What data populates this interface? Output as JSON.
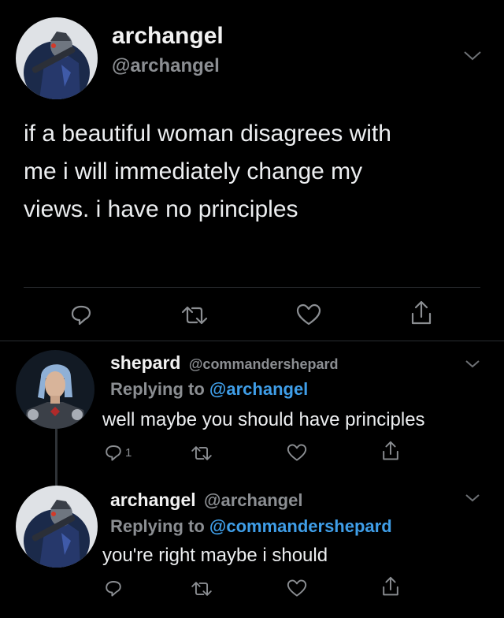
{
  "main_tweet": {
    "display_name": "archangel",
    "handle": "@archangel",
    "text_lines": [
      "if a beautiful woman disagrees with",
      "me i will immediately change my",
      "views. i have no principles"
    ],
    "avatar_icon": "garrus-avatar-icon"
  },
  "reply1": {
    "display_name": "shepard",
    "handle": "@commandershepard",
    "replying_label": "Replying to",
    "replying_to": "@archangel",
    "text": "well maybe you should have principles",
    "reply_count": "1",
    "avatar_icon": "shepard-avatar-icon"
  },
  "reply2": {
    "display_name": "archangel",
    "handle": "@archangel",
    "replying_label": "Replying to",
    "replying_to": "@commandershepard",
    "text": "you're right maybe i should",
    "avatar_icon": "garrus-avatar-icon"
  },
  "colors": {
    "background": "#000000",
    "text": "#e7e9ea",
    "muted": "#8b8e92",
    "link": "#3f9ee8"
  },
  "icons": [
    "reply-icon",
    "retweet-icon",
    "like-icon",
    "share-icon",
    "chevron-down-icon"
  ]
}
